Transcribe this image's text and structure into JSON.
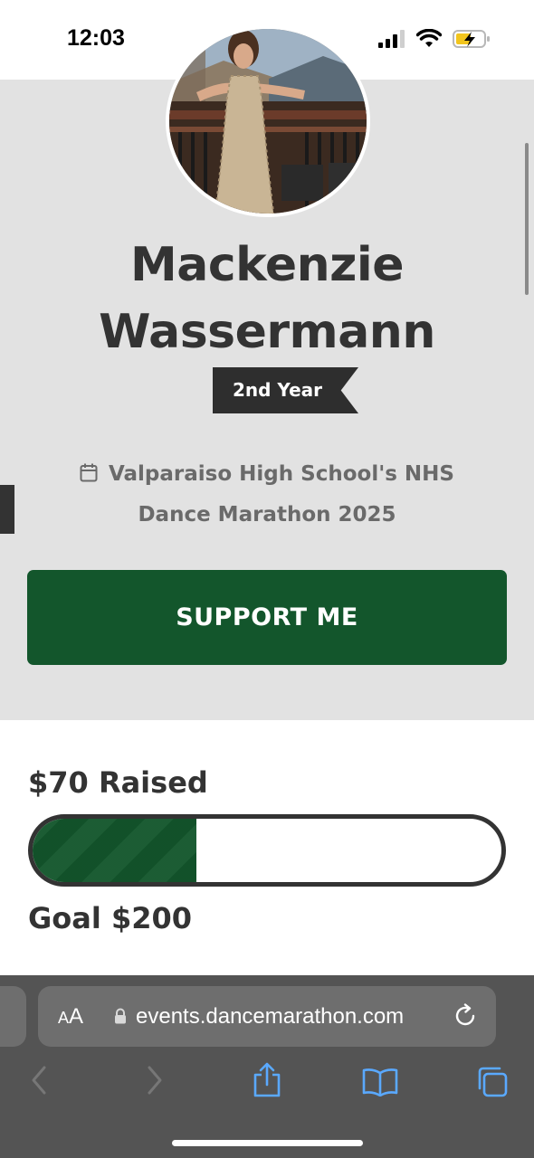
{
  "status_bar": {
    "time": "12:03",
    "icons": [
      "cellular-signal-icon",
      "wifi-icon",
      "battery-charging-icon"
    ]
  },
  "profile": {
    "name": "Mackenzie Wassermann",
    "badge": "2nd Year",
    "event_icon": "calendar-icon",
    "event": "Valparaiso High School's NHS Dance Marathon 2025"
  },
  "cta": {
    "support_label": "SUPPORT ME"
  },
  "fundraising": {
    "raised_label": "$70 Raised",
    "goal_label": "Goal $200",
    "raised_amount": 70,
    "goal_amount": 200,
    "progress_fraction": 0.35
  },
  "browser": {
    "aa_label_small": "A",
    "aa_label_large": "A",
    "url": "events.dancemarathon.com",
    "toolbar_icons": [
      "back-icon",
      "forward-icon",
      "share-icon",
      "bookmarks-icon",
      "tabs-icon"
    ]
  },
  "colors": {
    "brand_green": "#13562c",
    "hero_bg": "#e2e2e2",
    "text_dark": "#333333",
    "browser_accent": "#5aa9ff"
  }
}
